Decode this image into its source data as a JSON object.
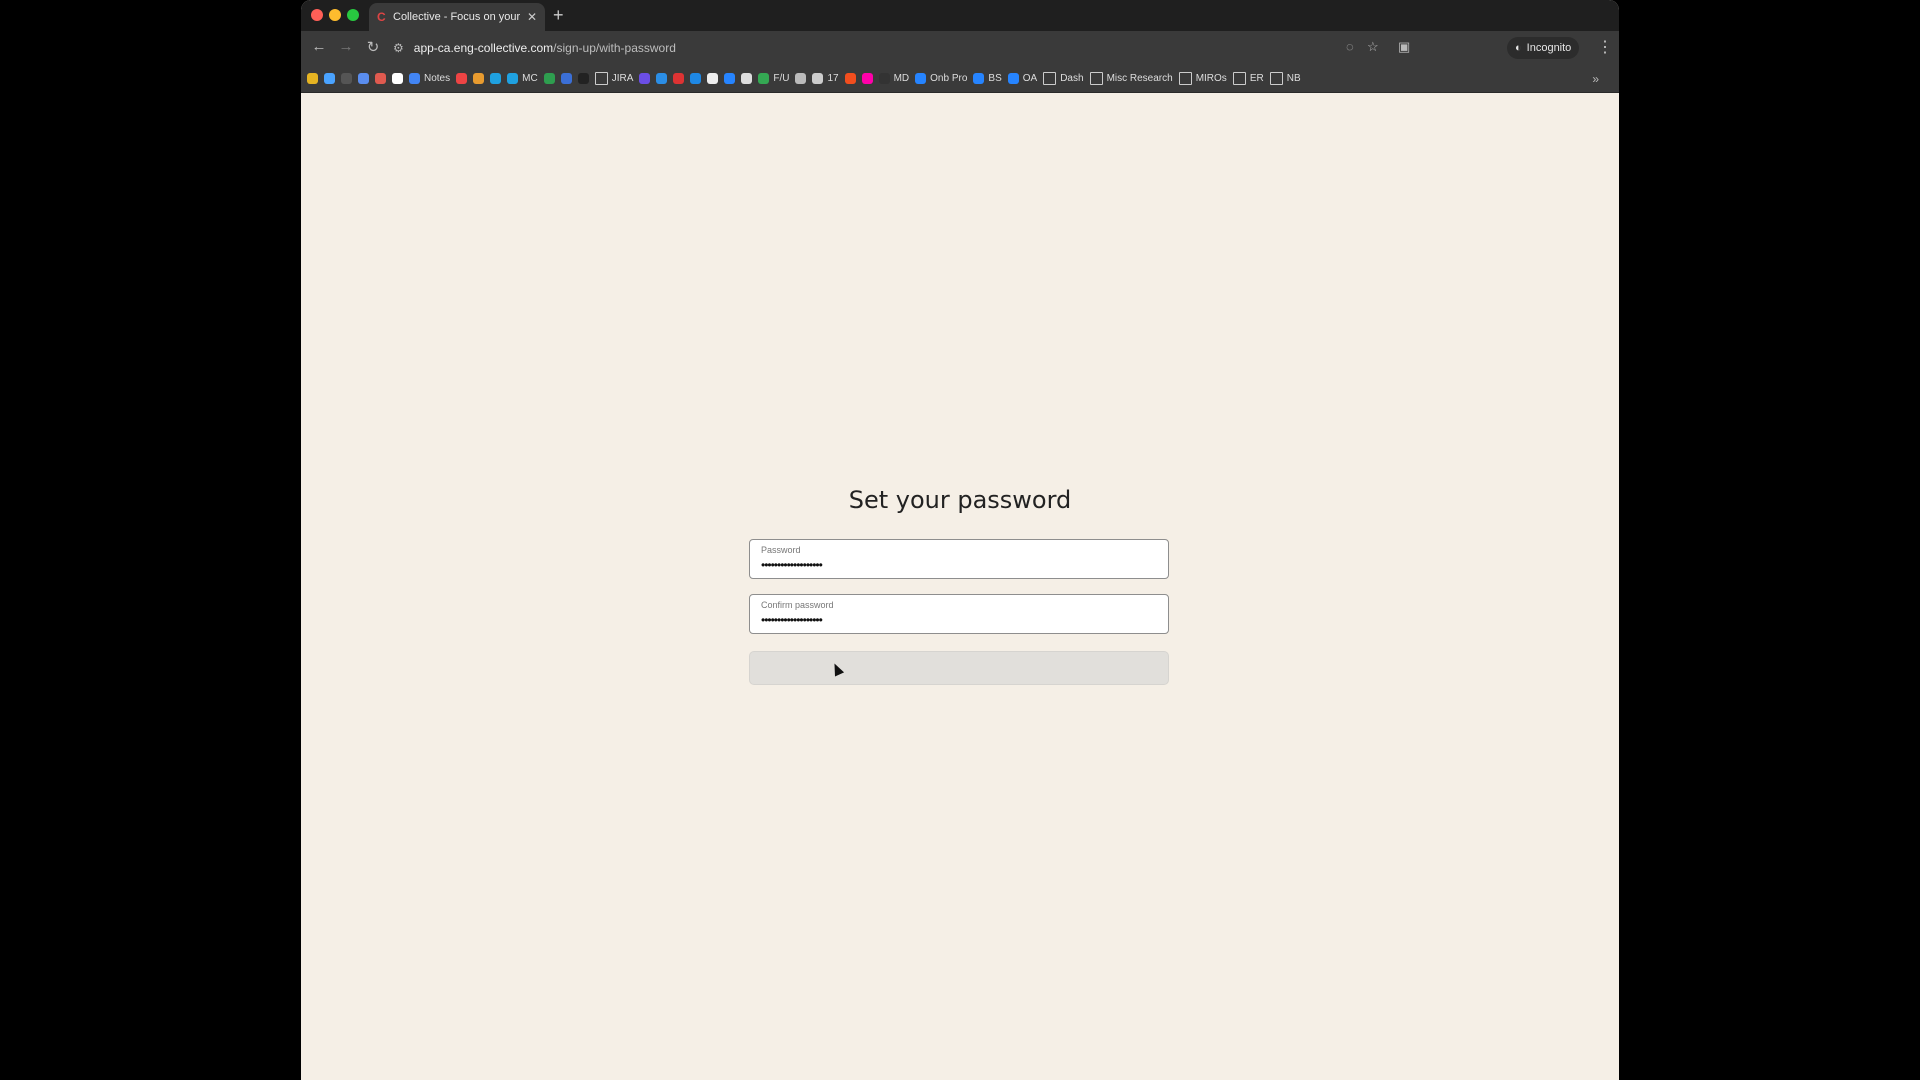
{
  "browser": {
    "tab": {
      "title": "Collective - Focus on your pa",
      "favicon": "collective-c-icon"
    },
    "url": {
      "domain": "app-ca.eng-collective.com",
      "path": "/sign-up/with-password"
    },
    "incognito_label": "Incognito",
    "bookmarks": [
      {
        "label": "",
        "icon": "app-icon",
        "color": "#e6b422"
      },
      {
        "label": "",
        "icon": "app-icon",
        "color": "#4aa3ff"
      },
      {
        "label": "",
        "icon": "app-icon",
        "color": "#555"
      },
      {
        "label": "",
        "icon": "app-icon",
        "color": "#5a8dee"
      },
      {
        "label": "",
        "icon": "app-icon",
        "color": "#e05a4f"
      },
      {
        "label": "",
        "icon": "app-icon",
        "color": "#ffffff"
      },
      {
        "label": "Notes",
        "icon": "doc-icon",
        "color": "#4285f4"
      },
      {
        "label": "",
        "icon": "app-icon",
        "color": "#e44"
      },
      {
        "label": "",
        "icon": "app-icon",
        "color": "#e89b2f"
      },
      {
        "label": "",
        "icon": "app-icon",
        "color": "#1fa1e0"
      },
      {
        "label": "MC",
        "icon": "salesforce-icon",
        "color": "#1fa1e0"
      },
      {
        "label": "",
        "icon": "app-icon",
        "color": "#2e9e4f"
      },
      {
        "label": "",
        "icon": "app-icon",
        "color": "#3b6fd6"
      },
      {
        "label": "",
        "icon": "app-icon",
        "color": "#222"
      },
      {
        "label": "JIRA",
        "icon": "folder-icon",
        "color": "#ccc"
      },
      {
        "label": "",
        "icon": "app-icon",
        "color": "#6b4ee6"
      },
      {
        "label": "",
        "icon": "app-icon",
        "color": "#2b8ee6"
      },
      {
        "label": "",
        "icon": "app-icon",
        "color": "#d33"
      },
      {
        "label": "",
        "icon": "app-icon",
        "color": "#1e88e5"
      },
      {
        "label": "",
        "icon": "app-icon",
        "color": "#eee"
      },
      {
        "label": "",
        "icon": "app-icon",
        "color": "#2684ff"
      },
      {
        "label": "",
        "icon": "app-icon",
        "color": "#ddd"
      },
      {
        "label": "F/U",
        "icon": "drive-icon",
        "color": "#34a853"
      },
      {
        "label": "",
        "icon": "app-icon",
        "color": "#bbb"
      },
      {
        "label": "17",
        "icon": "calendar-icon",
        "color": "#ccc"
      },
      {
        "label": "",
        "icon": "app-icon",
        "color": "#f24e1e"
      },
      {
        "label": "",
        "icon": "app-icon",
        "color": "#f0a"
      },
      {
        "label": "MD",
        "icon": "app-icon",
        "color": "#333"
      },
      {
        "label": "Onb Pro",
        "icon": "confluence-icon",
        "color": "#2684ff"
      },
      {
        "label": "BS",
        "icon": "confluence-icon",
        "color": "#2684ff"
      },
      {
        "label": "OA",
        "icon": "confluence-icon",
        "color": "#2684ff"
      },
      {
        "label": "Dash",
        "icon": "folder-icon",
        "color": "#ccc"
      },
      {
        "label": "Misc Research",
        "icon": "folder-icon",
        "color": "#ccc"
      },
      {
        "label": "MIROs",
        "icon": "folder-icon",
        "color": "#ccc"
      },
      {
        "label": "ER",
        "icon": "folder-icon",
        "color": "#ccc"
      },
      {
        "label": "NB",
        "icon": "folder-icon",
        "color": "#ccc"
      }
    ]
  },
  "form": {
    "heading": "Set your password",
    "password": {
      "label": "Password",
      "value": "•••••••••••••••••••"
    },
    "confirm": {
      "label": "Confirm password",
      "value": "•••••••••••••••••••"
    },
    "submit_state": "loading"
  }
}
